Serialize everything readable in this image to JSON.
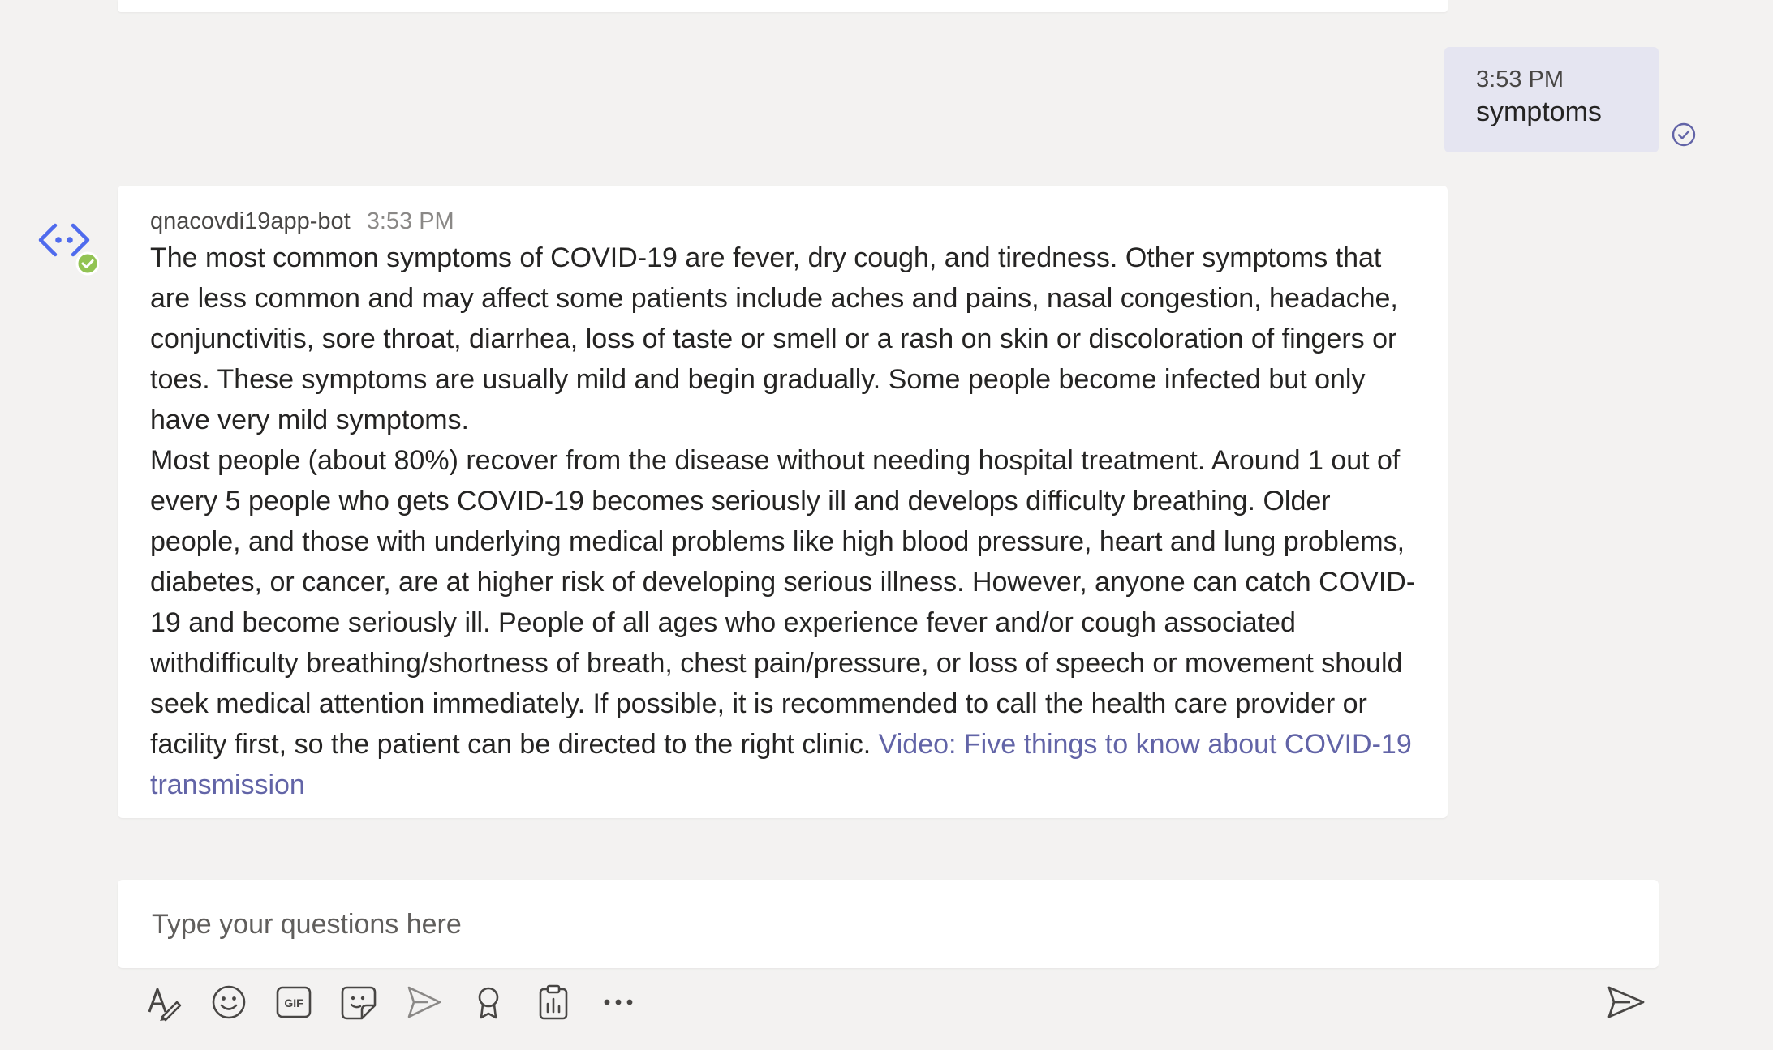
{
  "user_message": {
    "time": "3:53 PM",
    "text": "symptoms",
    "status_icon": "read-check-icon"
  },
  "bot_message": {
    "avatar_icon": "bot-code-icon",
    "sender": "qnacovdi19app-bot",
    "time": "3:53 PM",
    "paragraph_1": "The most common symptoms of COVID-19 are fever, dry cough, and tiredness. Other symptoms that are less common and may affect some patients include aches and pains, nasal congestion, headache, conjunctivitis, sore throat, diarrhea, loss of taste or smell or a rash on skin or discoloration of fingers or toes. These symptoms are usually mild and begin gradually. Some people become infected but only have very mild symptoms.",
    "paragraph_2": "Most people (about 80%) recover from the disease without needing hospital treatment. Around 1 out of every 5 people who gets COVID-19 becomes seriously ill and develops difficulty breathing. Older people, and those with underlying medical problems like high blood pressure, heart and lung problems, diabetes, or cancer, are at higher risk of developing serious illness.  However, anyone can catch COVID-19 and become seriously ill.  People of all ages who experience fever and/or  cough associated withdifficulty breathing/shortness of breath, chest pain/pressure, or loss of speech or movement should seek medical attention immediately. If possible, it is recommended to call the health care provider or facility first, so the patient can be directed to the right clinic. ",
    "link_text": "Video: Five things to know about COVID-19 transmission"
  },
  "compose": {
    "placeholder": "Type your questions here",
    "value": ""
  },
  "toolbar": {
    "items": [
      "format-icon",
      "emoji-icon",
      "gif-icon",
      "sticker-icon",
      "meet-now-icon",
      "praise-icon",
      "clipboard-icon",
      "more-options-icon"
    ],
    "send_icon": "send-icon"
  },
  "colors": {
    "background": "#f3f2f1",
    "user_bubble": "#e5e5f1",
    "accent": "#6264a7",
    "bot_blue": "#4f6bed",
    "status_green": "#92c353"
  }
}
